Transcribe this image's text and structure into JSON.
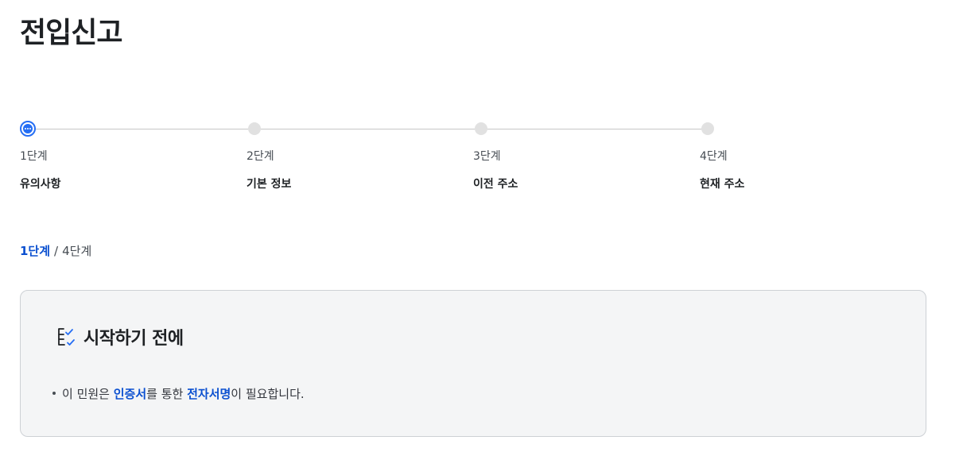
{
  "page": {
    "title": "전입신고"
  },
  "stepper": {
    "steps": [
      {
        "num": "1단계",
        "label": "유의사항",
        "state": "current"
      },
      {
        "num": "2단계",
        "label": "기본 정보",
        "state": "upcoming"
      },
      {
        "num": "3단계",
        "label": "이전 주소",
        "state": "upcoming"
      },
      {
        "num": "4단계",
        "label": "현재 주소",
        "state": "upcoming"
      }
    ]
  },
  "progress": {
    "current": "1단계",
    "separator": "/",
    "total": "4단계"
  },
  "notice": {
    "icon": "checklist-icon",
    "title": "시작하기 전에",
    "item": {
      "part1": "이 민원은 ",
      "em1": "인증서",
      "part2": "를 통한 ",
      "em2": "전자서명",
      "part3": "이 필요합니다."
    }
  },
  "colors": {
    "accent": "#256ef4",
    "accent_text": "#0b50d0",
    "inactive_dot": "#e1e1e1",
    "box_bg": "#f4f5f6"
  }
}
